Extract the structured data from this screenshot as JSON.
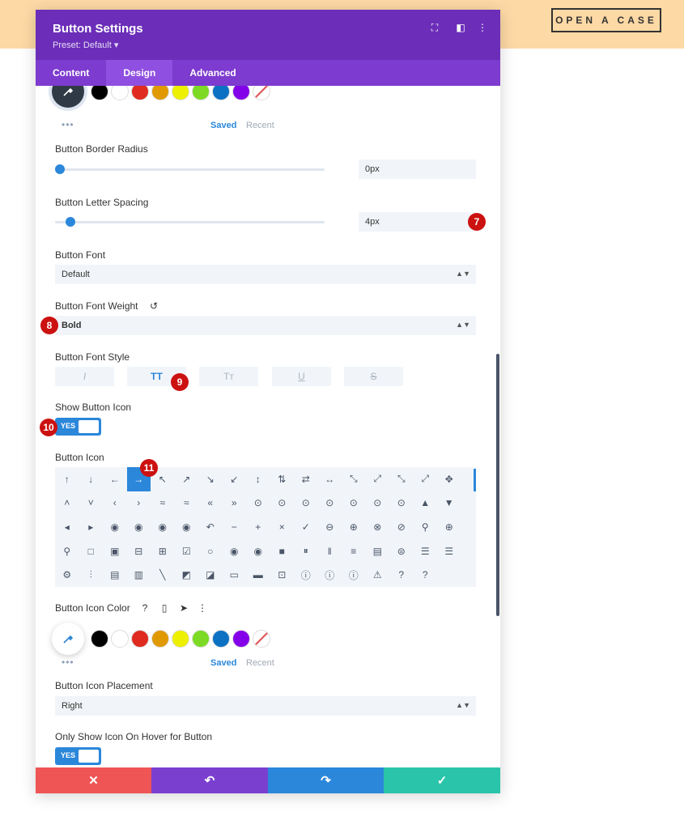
{
  "site": {
    "cta": "OPEN A CASE"
  },
  "modal": {
    "title": "Button Settings",
    "preset": "Preset: Default ▾",
    "tabs": [
      "Content",
      "Design",
      "Advanced"
    ],
    "active_tab": "Design"
  },
  "palette": {
    "colors": [
      "#000000",
      "#ffffff",
      "#e02b20",
      "#e09900",
      "#edf000",
      "#7cda24",
      "#0c71c3",
      "#8300e9"
    ],
    "saved_label": "Saved",
    "recent_label": "Recent",
    "more": "•••"
  },
  "fields": {
    "border_radius": {
      "label": "Button Border Radius",
      "value": "0px",
      "slider": 0.0
    },
    "letter_spacing": {
      "label": "Button Letter Spacing",
      "value": "4px",
      "slider": 0.04
    },
    "font": {
      "label": "Button Font",
      "value": "Default"
    },
    "font_weight": {
      "label": "Button Font Weight",
      "value": "Bold"
    },
    "font_style": {
      "label": "Button Font Style",
      "options": [
        "I",
        "TT",
        "Tт",
        "U",
        "S"
      ],
      "active": "TT"
    },
    "show_icon": {
      "label": "Show Button Icon",
      "value": "YES"
    },
    "icon": {
      "label": "Button Icon"
    },
    "icon_color": {
      "label": "Button Icon Color"
    },
    "icon_placement": {
      "label": "Button Icon Placement",
      "value": "Right"
    },
    "hover_icon": {
      "label": "Only Show Icon On Hover for Button",
      "value": "YES"
    }
  },
  "icons": [
    "↑",
    "↓",
    "←",
    "→",
    "↖",
    "↗",
    "↘",
    "↙",
    "↕",
    "⇅",
    "⇄",
    "↔",
    "⤡",
    "⤢",
    "⤡",
    "⤢",
    "✥",
    "˄",
    "˅",
    "‹",
    "›",
    "≈",
    "≈",
    "«",
    "»",
    "⊙",
    "⊙",
    "⊙",
    "⊙",
    "⊙",
    "⊙",
    "⊙",
    "▲",
    "▼",
    "◂",
    "▸",
    "◉",
    "◉",
    "◉",
    "◉",
    "↶",
    "−",
    "+",
    "×",
    "✓",
    "⊖",
    "⊕",
    "⊗",
    "⊘",
    "⚲",
    "⊕",
    "⚲",
    "□",
    "▣",
    "⊟",
    "⊞",
    "☑",
    "○",
    "◉",
    "◉",
    "■",
    "⏸",
    "‖",
    "≡",
    "▤",
    "⊜",
    "☰",
    "☰",
    "⚙",
    "⫶",
    "▤",
    "▥",
    "╲",
    "◩",
    "◪",
    "▭",
    "▬",
    "⊡",
    "ⓘ",
    "ⓘ",
    "ⓘ",
    "⚠",
    "?",
    "?"
  ],
  "selected_icon": "→",
  "annotations": [
    "7",
    "8",
    "9",
    "10",
    "11"
  ],
  "footer": {
    "cancel": "✕",
    "undo": "↶",
    "redo": "↷",
    "save": "✓"
  },
  "colors": {
    "header": "#6c2eb9",
    "tabs": "#7d3bcf",
    "accent": "#2b87da",
    "cancel": "#ef5555",
    "undo": "#7b3fd0",
    "redo": "#2b87da",
    "save": "#29c4a9",
    "top_bar": "#fdd9a5",
    "annotation": "#cc1111"
  }
}
